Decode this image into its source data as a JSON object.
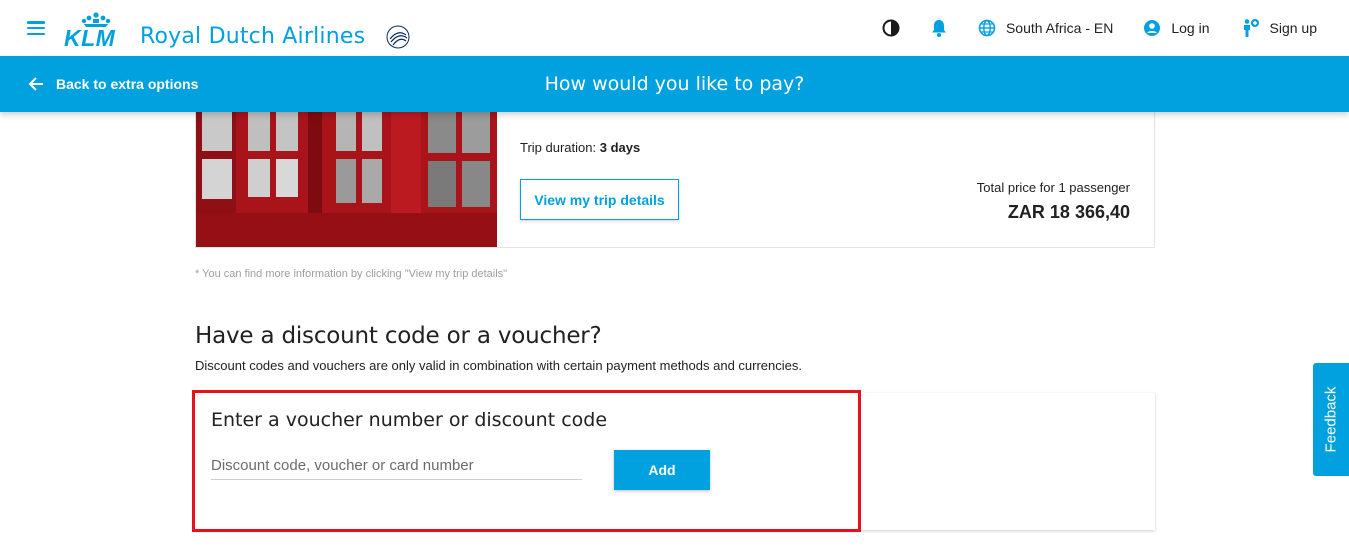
{
  "header": {
    "brand_short": "KLM",
    "brand_name": "Royal Dutch Airlines",
    "region_label": "South Africa - EN",
    "login_label": "Log in",
    "signup_label": "Sign up",
    "icons": [
      "menu-icon",
      "contrast-icon",
      "bell-icon",
      "globe-icon",
      "user-icon",
      "person-add-icon"
    ],
    "colors": {
      "brand": "#00a1de"
    }
  },
  "navbar": {
    "back_label": "Back to extra options",
    "title": "How would you like to pay?"
  },
  "trip": {
    "duration_label": "Trip duration:",
    "duration_value": "3 days",
    "details_button": "View my trip details",
    "price_label": "Total price for 1 passenger",
    "price_value": "ZAR 18 366,40",
    "footnote": "* You can find more information by clicking \"View my trip details\""
  },
  "discount": {
    "title": "Have a discount code or a voucher?",
    "subtitle": "Discount codes and vouchers are only valid in combination with certain payment methods and currencies.",
    "card_heading": "Enter a voucher number or discount code",
    "input_placeholder": "Discount code, voucher or card number",
    "input_value": "",
    "add_button": "Add",
    "highlight_color": "#e8101a"
  },
  "feedback_label": "Feedback"
}
